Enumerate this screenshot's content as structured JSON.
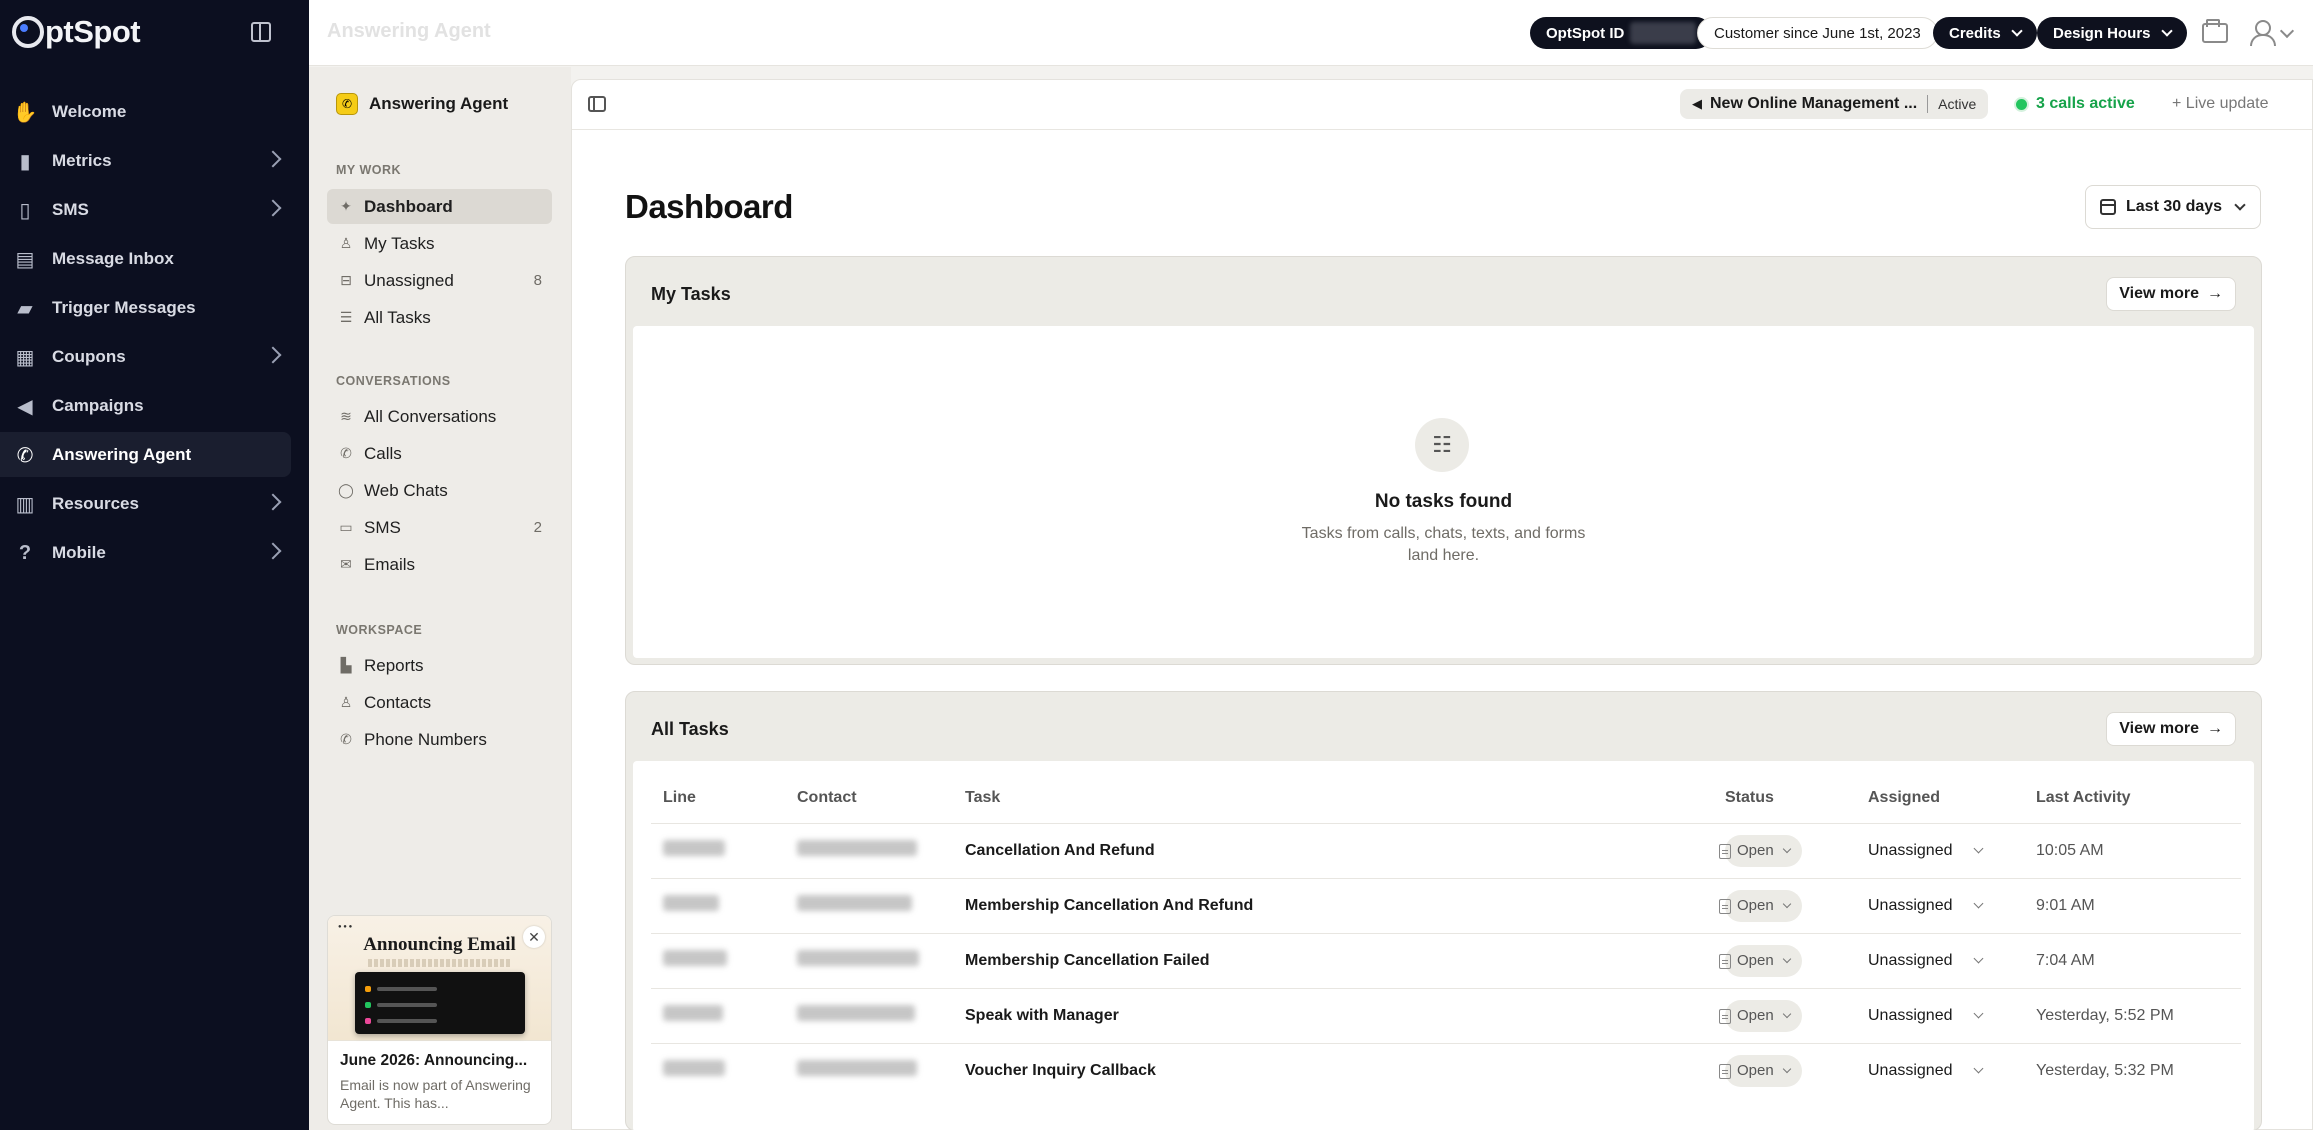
{
  "app": {
    "logo_text": "ptSpot"
  },
  "sidebar": {
    "items": [
      {
        "label": "Welcome",
        "icon": "hand-wave-icon",
        "has_submenu": false
      },
      {
        "label": "Metrics",
        "icon": "bar-chart-icon",
        "has_submenu": true
      },
      {
        "label": "SMS",
        "icon": "phone-mobile-icon",
        "has_submenu": true
      },
      {
        "label": "Message Inbox",
        "icon": "inbox-icon",
        "has_submenu": false
      },
      {
        "label": "Trigger Messages",
        "icon": "chat-bubble-icon",
        "has_submenu": false
      },
      {
        "label": "Coupons",
        "icon": "ticket-icon",
        "has_submenu": true
      },
      {
        "label": "Campaigns",
        "icon": "megaphone-icon",
        "has_submenu": false
      },
      {
        "label": "Answering Agent",
        "icon": "phone-icon",
        "has_submenu": false,
        "active": true
      },
      {
        "label": "Resources",
        "icon": "book-icon",
        "has_submenu": true
      },
      {
        "label": "Mobile",
        "icon": "help-circle-icon",
        "has_submenu": true
      }
    ]
  },
  "topbar": {
    "title": "Answering Agent",
    "optspot_id_label": "OptSpot ID",
    "customer_since": "Customer since June 1st, 2023",
    "credits_label": "Credits",
    "design_hours_label": "Design Hours"
  },
  "subnav": {
    "title": "Answering Agent",
    "sections": {
      "my_work": "MY WORK",
      "conversations": "CONVERSATIONS",
      "workspace": "WORKSPACE"
    },
    "my_work": [
      {
        "label": "Dashboard",
        "icon": "sparkle-icon",
        "active": true
      },
      {
        "label": "My Tasks",
        "icon": "user-icon"
      },
      {
        "label": "Unassigned",
        "icon": "inbox-tray-icon",
        "count": "8"
      },
      {
        "label": "All Tasks",
        "icon": "checklist-icon"
      }
    ],
    "conversations": [
      {
        "label": "All Conversations",
        "icon": "waveform-icon"
      },
      {
        "label": "Calls",
        "icon": "phone-icon"
      },
      {
        "label": "Web Chats",
        "icon": "chat-circle-icon"
      },
      {
        "label": "SMS",
        "icon": "message-square-icon",
        "count": "2"
      },
      {
        "label": "Emails",
        "icon": "mail-icon"
      }
    ],
    "workspace": [
      {
        "label": "Reports",
        "icon": "chart-icon"
      },
      {
        "label": "Contacts",
        "icon": "contacts-icon"
      },
      {
        "label": "Phone Numbers",
        "icon": "phone-icon"
      }
    ],
    "promo": {
      "image_title": "Announcing Email",
      "title": "June 2026: Announcing...",
      "description": "Email is now part of Answering Agent. This has..."
    }
  },
  "main_bar": {
    "agent_name": "New Online Management ...",
    "agent_status": "Active",
    "calls_active": "3 calls active",
    "live_update": "+ Live update"
  },
  "dashboard": {
    "title": "Dashboard",
    "date_range": "Last 30 days",
    "my_tasks": {
      "title": "My Tasks",
      "view_more": "View more",
      "empty_title": "No tasks found",
      "empty_line1": "Tasks from calls, chats, texts, and forms",
      "empty_line2": "land here."
    },
    "all_tasks": {
      "title": "All Tasks",
      "view_more": "View more",
      "columns": [
        "Line",
        "Contact",
        "Task",
        "Status",
        "Assigned",
        "Last Activity"
      ],
      "rows": [
        {
          "task": "Cancellation And Refund",
          "status": "Open",
          "assigned": "Unassigned",
          "last_activity": "10:05 AM"
        },
        {
          "task": "Membership Cancellation And Refund",
          "status": "Open",
          "assigned": "Unassigned",
          "last_activity": "9:01 AM"
        },
        {
          "task": "Membership Cancellation Failed",
          "status": "Open",
          "assigned": "Unassigned",
          "last_activity": "7:04 AM"
        },
        {
          "task": "Speak with Manager",
          "status": "Open",
          "assigned": "Unassigned",
          "last_activity": "Yesterday, 5:52 PM"
        },
        {
          "task": "Voucher Inquiry Callback",
          "status": "Open",
          "assigned": "Unassigned",
          "last_activity": "Yesterday, 5:32 PM"
        }
      ]
    }
  }
}
